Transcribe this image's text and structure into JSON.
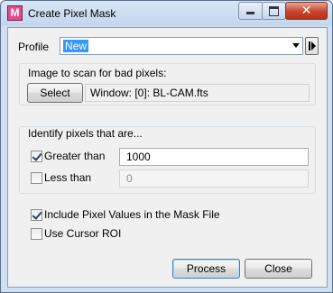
{
  "window": {
    "title": "Create Pixel Mask",
    "icon_letter": "M",
    "icon": "pixel-mask-app-icon"
  },
  "title_controls": {
    "minimize_icon": "minimize-icon",
    "maximize_icon": "maximize-icon",
    "close_glyph": "✕"
  },
  "profile": {
    "label": "Profile",
    "value": "New",
    "next_icon": "next-profile-icon"
  },
  "scan": {
    "heading": "Image to scan for bad pixels:",
    "select_label": "Select",
    "window_value": "Window: [0]: BL-CAM.fts"
  },
  "identify": {
    "heading": "Identify pixels that are...",
    "greater_label": "Greater than",
    "greater_checked": true,
    "greater_value": "1000",
    "less_label": "Less than",
    "less_checked": false,
    "less_value": "0"
  },
  "options": {
    "include_label": "Include Pixel Values in the Mask File",
    "include_checked": true,
    "cursor_label": "Use Cursor ROI",
    "cursor_checked": false
  },
  "buttons": {
    "process_label": "Process",
    "close_label": "Close"
  },
  "colors": {
    "accent_selection": "#3399ff",
    "title_bg": "#c3d6ee",
    "close_button": "#c7432a"
  }
}
